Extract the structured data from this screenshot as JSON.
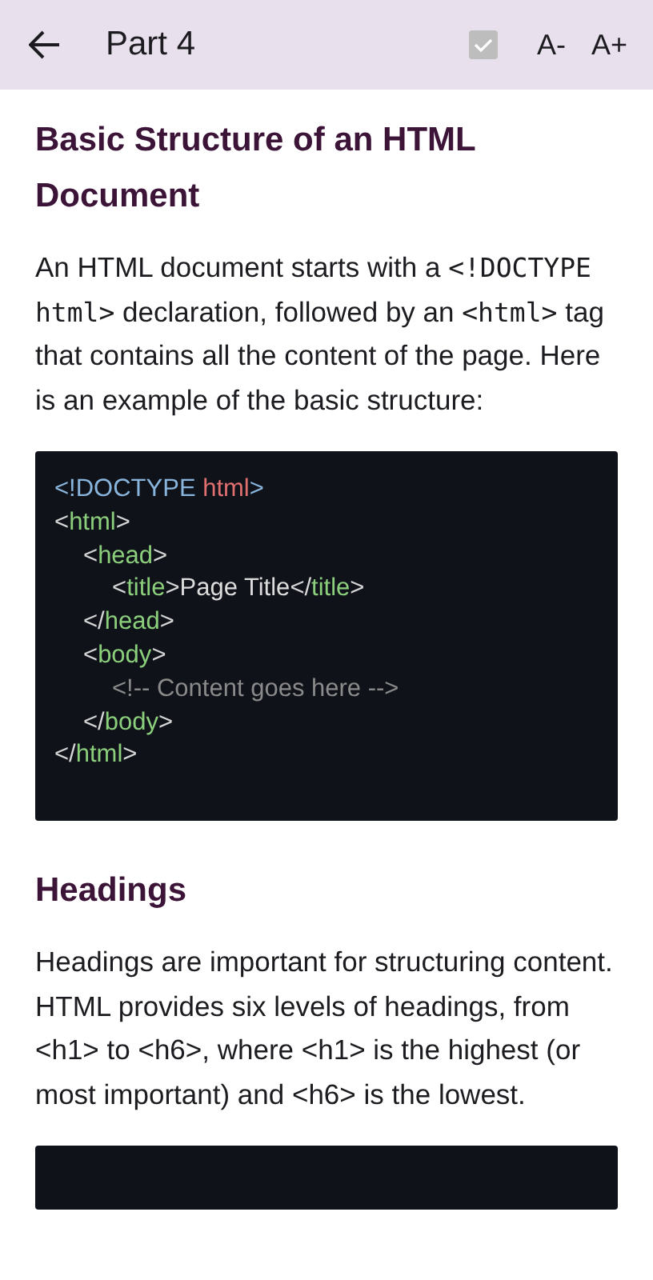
{
  "app_bar": {
    "title": "Part 4",
    "completed_checked": true,
    "font_decrease": "A-",
    "font_increase": "A+"
  },
  "content": [
    {
      "kind": "heading",
      "text": "Basic Structure of an HTML Document"
    },
    {
      "kind": "paragraph",
      "segments": [
        {
          "kind": "text",
          "text": "An HTML document starts with a "
        },
        {
          "kind": "code",
          "text": "<!DOCTYPE html>"
        },
        {
          "kind": "text",
          "text": " declaration, followed by an "
        },
        {
          "kind": "code",
          "text": "<html>"
        },
        {
          "kind": "text",
          "text": " tag that contains all the content of the page. Here is an example of the basic structure:"
        }
      ]
    },
    {
      "kind": "code",
      "lines": [
        {
          "tokens": [
            {
              "kind": "doctype",
              "text": "<!DOCTYPE "
            },
            {
              "kind": "keyword",
              "text": "html"
            },
            {
              "kind": "doctype",
              "text": ">"
            }
          ]
        },
        {
          "tokens": [
            {
              "kind": "punct",
              "text": "<"
            },
            {
              "kind": "tag",
              "text": "html"
            },
            {
              "kind": "punct",
              "text": ">"
            }
          ],
          "children": [
            {
              "tokens": [
                {
                  "kind": "punct",
                  "text": "<"
                },
                {
                  "kind": "tag",
                  "text": "head"
                },
                {
                  "kind": "punct",
                  "text": ">"
                }
              ],
              "children": [
                {
                  "tokens": [
                    {
                      "kind": "punct",
                      "text": "<"
                    },
                    {
                      "kind": "tag",
                      "text": "title"
                    },
                    {
                      "kind": "punct",
                      "text": ">"
                    },
                    {
                      "kind": "text",
                      "text": "Page Title"
                    },
                    {
                      "kind": "punct",
                      "text": "</"
                    },
                    {
                      "kind": "tag",
                      "text": "title"
                    },
                    {
                      "kind": "punct",
                      "text": ">"
                    }
                  ]
                }
              ]
            },
            {
              "tokens": [
                {
                  "kind": "punct",
                  "text": "</"
                },
                {
                  "kind": "tag",
                  "text": "head"
                },
                {
                  "kind": "punct",
                  "text": ">"
                }
              ]
            },
            {
              "tokens": [
                {
                  "kind": "punct",
                  "text": "<"
                },
                {
                  "kind": "tag",
                  "text": "body"
                },
                {
                  "kind": "punct",
                  "text": ">"
                }
              ],
              "children": [
                {
                  "tokens": [
                    {
                      "kind": "comment",
                      "text": "<!-- Content goes here -->"
                    }
                  ]
                }
              ]
            },
            {
              "tokens": [
                {
                  "kind": "punct",
                  "text": "</"
                },
                {
                  "kind": "tag",
                  "text": "body"
                },
                {
                  "kind": "punct",
                  "text": ">"
                }
              ]
            }
          ]
        },
        {
          "tokens": [
            {
              "kind": "punct",
              "text": "</"
            },
            {
              "kind": "tag",
              "text": "html"
            },
            {
              "kind": "punct",
              "text": ">"
            }
          ]
        }
      ]
    },
    {
      "kind": "heading",
      "text": "Headings"
    },
    {
      "kind": "paragraph",
      "segments": [
        {
          "kind": "text",
          "text": "Headings are important for structuring content. HTML provides six levels of headings, from <h1> to <h6>, where <h1> is the highest (or most important) and <h6> is the lowest."
        }
      ]
    },
    {
      "kind": "code"
    }
  ]
}
